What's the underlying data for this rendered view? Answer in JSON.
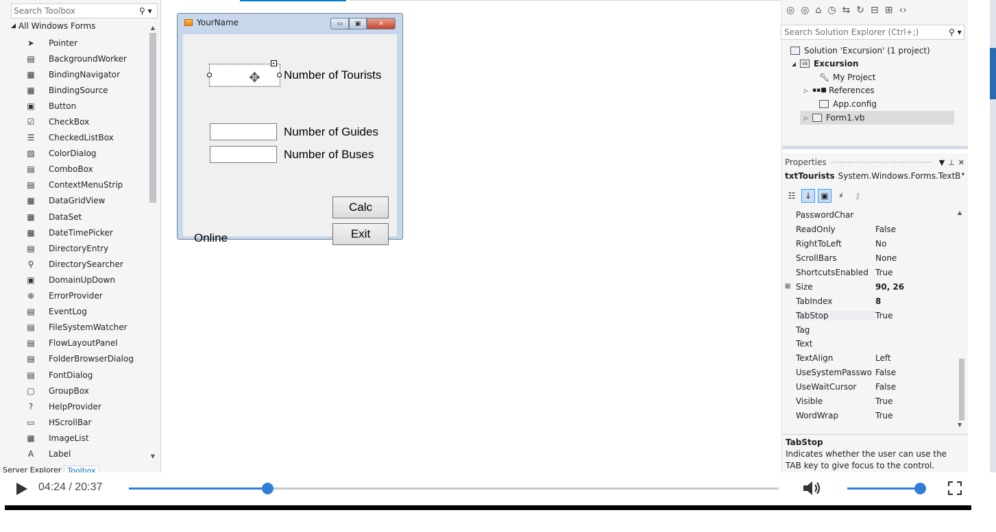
{
  "toolbox": {
    "search_placeholder": "Search Toolbox",
    "group_label": "All Windows Forms",
    "items": [
      {
        "label": "Pointer",
        "icon": "pointer-icon",
        "glyph": "➤"
      },
      {
        "label": "BackgroundWorker",
        "icon": "background-worker-icon",
        "glyph": "▤"
      },
      {
        "label": "BindingNavigator",
        "icon": "binding-navigator-icon",
        "glyph": "▦"
      },
      {
        "label": "BindingSource",
        "icon": "binding-source-icon",
        "glyph": "▦"
      },
      {
        "label": "Button",
        "icon": "button-icon",
        "glyph": "▣"
      },
      {
        "label": "CheckBox",
        "icon": "checkbox-icon",
        "glyph": "☑"
      },
      {
        "label": "CheckedListBox",
        "icon": "checked-list-box-icon",
        "glyph": "☰"
      },
      {
        "label": "ColorDialog",
        "icon": "color-dialog-icon",
        "glyph": "▨"
      },
      {
        "label": "ComboBox",
        "icon": "combobox-icon",
        "glyph": "▤"
      },
      {
        "label": "ContextMenuStrip",
        "icon": "context-menu-strip-icon",
        "glyph": "▤"
      },
      {
        "label": "DataGridView",
        "icon": "data-grid-view-icon",
        "glyph": "▦"
      },
      {
        "label": "DataSet",
        "icon": "dataset-icon",
        "glyph": "▦"
      },
      {
        "label": "DateTimePicker",
        "icon": "date-time-picker-icon",
        "glyph": "▦"
      },
      {
        "label": "DirectoryEntry",
        "icon": "directory-entry-icon",
        "glyph": "▤"
      },
      {
        "label": "DirectorySearcher",
        "icon": "directory-searcher-icon",
        "glyph": "⚲"
      },
      {
        "label": "DomainUpDown",
        "icon": "domain-up-down-icon",
        "glyph": "▣"
      },
      {
        "label": "ErrorProvider",
        "icon": "error-provider-icon",
        "glyph": "⊗"
      },
      {
        "label": "EventLog",
        "icon": "event-log-icon",
        "glyph": "▤"
      },
      {
        "label": "FileSystemWatcher",
        "icon": "file-system-watcher-icon",
        "glyph": "▤"
      },
      {
        "label": "FlowLayoutPanel",
        "icon": "flow-layout-panel-icon",
        "glyph": "▤"
      },
      {
        "label": "FolderBrowserDialog",
        "icon": "folder-browser-dialog-icon",
        "glyph": "▤"
      },
      {
        "label": "FontDialog",
        "icon": "font-dialog-icon",
        "glyph": "▤"
      },
      {
        "label": "GroupBox",
        "icon": "group-box-icon",
        "glyph": "▢"
      },
      {
        "label": "HelpProvider",
        "icon": "help-provider-icon",
        "glyph": "?"
      },
      {
        "label": "HScrollBar",
        "icon": "hscrollbar-icon",
        "glyph": "▭"
      },
      {
        "label": "ImageList",
        "icon": "image-list-icon",
        "glyph": "▦"
      },
      {
        "label": "Label",
        "icon": "label-icon",
        "glyph": "A"
      }
    ],
    "tabs": [
      "Server Explorer",
      "Toolbox"
    ]
  },
  "form": {
    "title": "YourName",
    "labels": {
      "tourists": "Number of Tourists",
      "guides": "Number of Guides",
      "buses": "Number of Buses",
      "status": "Online"
    },
    "buttons": {
      "calc": "Calc",
      "exit": "Exit"
    }
  },
  "solution_explorer": {
    "search_placeholder": "Search Solution Explorer (Ctrl+;)",
    "nodes": {
      "solution": "Solution 'Excursion' (1 project)",
      "project": "Excursion",
      "my_project": "My Project",
      "references": "References",
      "app_config": "App.config",
      "form1": "Form1.vb"
    }
  },
  "properties": {
    "header": "Properties",
    "object_name": "txtTourists",
    "object_type": "System.Windows.Forms.TextB",
    "rows": [
      {
        "name": "PasswordChar",
        "value": "",
        "bold": false
      },
      {
        "name": "ReadOnly",
        "value": "False",
        "bold": false
      },
      {
        "name": "RightToLeft",
        "value": "No",
        "bold": false
      },
      {
        "name": "ScrollBars",
        "value": "None",
        "bold": false
      },
      {
        "name": "ShortcutsEnabled",
        "value": "True",
        "bold": false
      },
      {
        "name": "Size",
        "value": "90, 26",
        "bold": true,
        "expandable": true
      },
      {
        "name": "TabIndex",
        "value": "8",
        "bold": true
      },
      {
        "name": "TabStop",
        "value": "True",
        "bold": false,
        "highlight": true
      },
      {
        "name": "Tag",
        "value": "",
        "bold": false
      },
      {
        "name": "Text",
        "value": "",
        "bold": false
      },
      {
        "name": "TextAlign",
        "value": "Left",
        "bold": false
      },
      {
        "name": "UseSystemPasswo",
        "value": "False",
        "bold": false
      },
      {
        "name": "UseWaitCursor",
        "value": "False",
        "bold": false
      },
      {
        "name": "Visible",
        "value": "True",
        "bold": false
      },
      {
        "name": "WordWrap",
        "value": "True",
        "bold": false
      }
    ],
    "description_title": "TabStop",
    "description_text": "Indicates whether the user can use the TAB key to give focus to the control."
  },
  "player": {
    "time": "04:24 / 20:37",
    "progress_fraction": 0.213,
    "volume_fraction": 0.98,
    "accent_color": "#2f7fd8"
  }
}
